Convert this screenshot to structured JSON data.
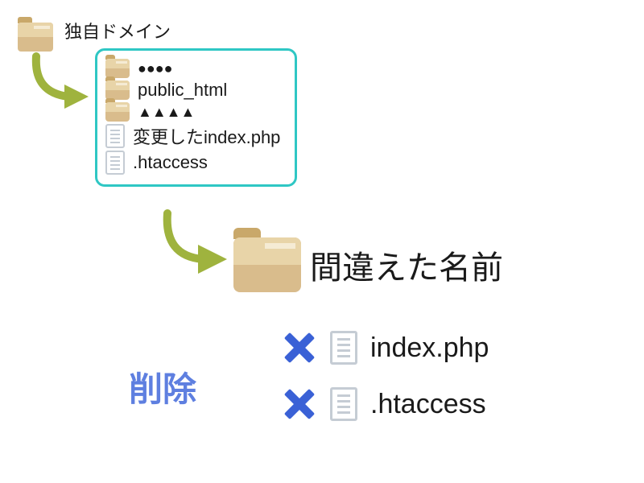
{
  "root": {
    "label": "独自ドメイン"
  },
  "group": {
    "items": [
      {
        "label": "●●●●",
        "type": "folder"
      },
      {
        "label": "public_html",
        "type": "folder"
      },
      {
        "label": "▲▲▲▲",
        "type": "folder"
      },
      {
        "label": "変更したindex.php",
        "type": "file"
      },
      {
        "label": ".htaccess",
        "type": "file"
      }
    ]
  },
  "wrong_folder": {
    "label": "間違えた名前"
  },
  "delete": {
    "label": "削除",
    "files": [
      {
        "label": "index.php"
      },
      {
        "label": ".htaccess"
      }
    ]
  }
}
